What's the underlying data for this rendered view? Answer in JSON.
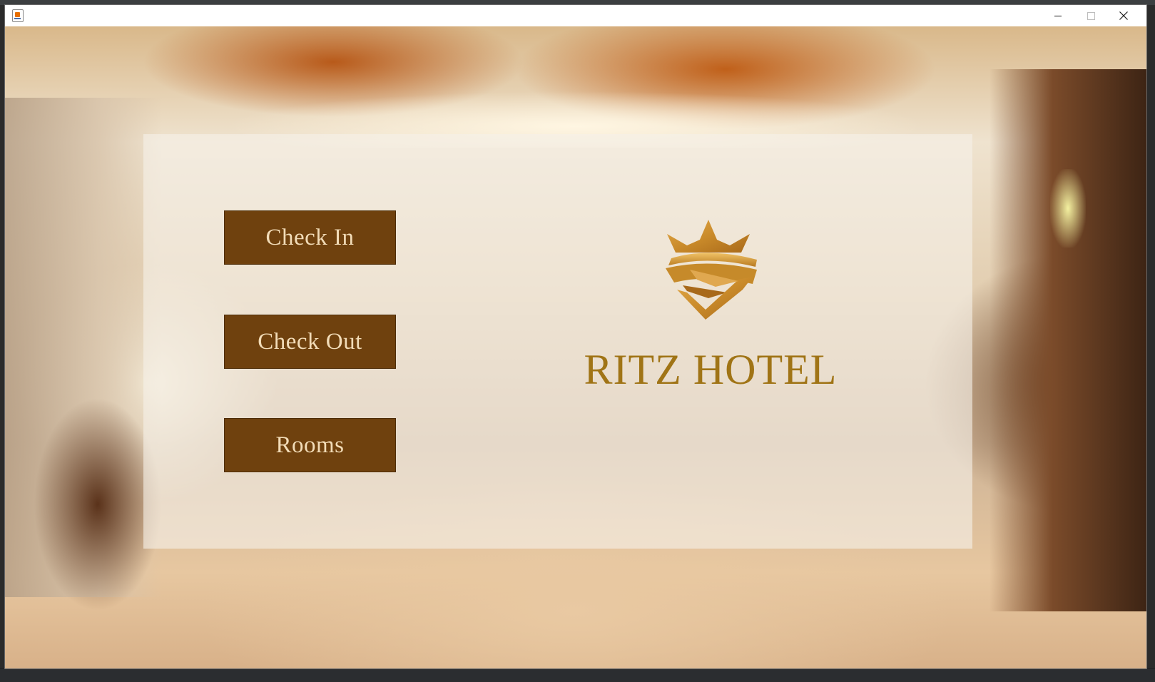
{
  "window": {
    "title": "",
    "controls": {
      "minimize_icon": "minimize-icon",
      "maximize_icon": "maximize-icon",
      "close_icon": "close-icon"
    }
  },
  "menu": {
    "check_in_label": "Check In",
    "check_out_label": "Check Out",
    "rooms_label": "Rooms"
  },
  "brand": {
    "name": "RITZ HOTEL",
    "logo_icon": "crown-shield-logo",
    "name_color": "#a07416",
    "button_color": "#6f410e",
    "button_text_color": "#f2dcb8"
  }
}
